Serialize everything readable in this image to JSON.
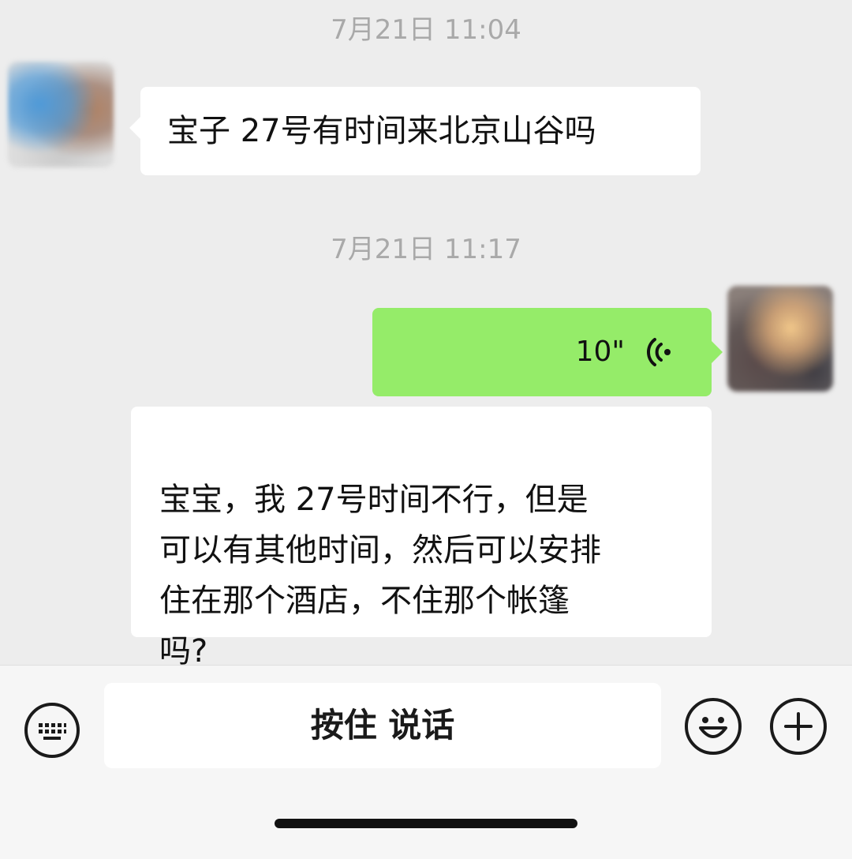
{
  "conversation": {
    "timestamps": [
      "7月21日 11:04",
      "7月21日 11:17"
    ],
    "messages": [
      {
        "sender": "contact",
        "type": "text",
        "text": "宝子 27号有时间来北京山谷吗"
      },
      {
        "sender": "me",
        "type": "voice",
        "duration": "10\""
      },
      {
        "sender": "contact",
        "type": "text",
        "text": "宝宝，我 27号时间不行，但是\n可以有其他时间，然后可以安排\n住在那个酒店，不住那个帐篷\n吗?"
      }
    ]
  },
  "input_bar": {
    "hold_to_talk_label": "按住 说话",
    "left_icon": "keyboard-icon",
    "right_icons": [
      "emoji-icon",
      "plus-icon"
    ]
  },
  "colors": {
    "background": "#ededed",
    "bubble_incoming": "#ffffff",
    "bubble_outgoing": "#95ec69",
    "timestamp": "#a9a9a9",
    "text": "#111111"
  }
}
